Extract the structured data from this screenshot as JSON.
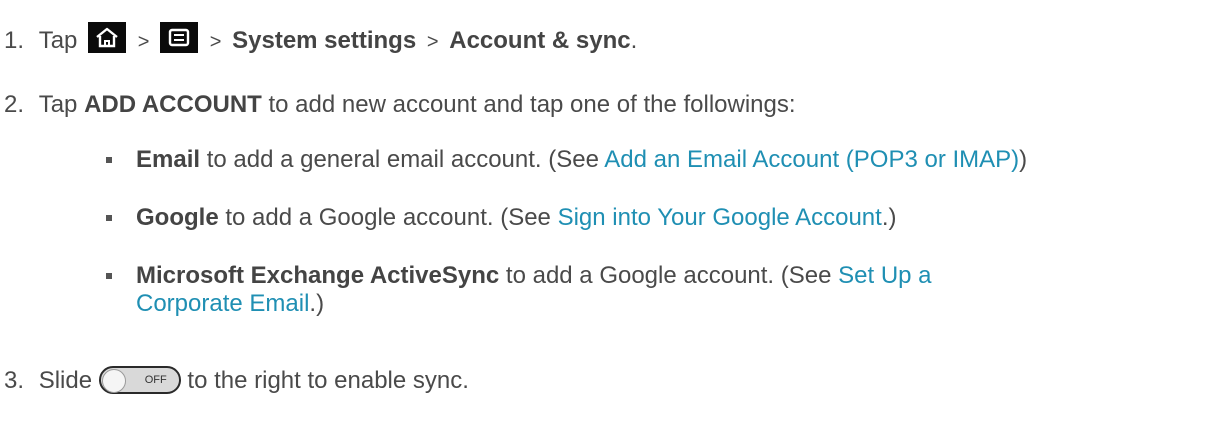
{
  "steps": [
    {
      "number": "1.",
      "tap": "Tap",
      "sep1": ">",
      "sep2": ">",
      "system_settings": "System settings",
      "sep3": ">",
      "account_sync": "Account & sync",
      "end": ".",
      "icons": [
        "home-icon",
        "menu-icon"
      ]
    },
    {
      "number": "2.",
      "tap": "Tap",
      "add_account": "ADD ACCOUNT",
      "rest": "to add new account and tap one of the followings:"
    },
    {
      "number": "3.",
      "slide": "Slide",
      "toggle_label": "OFF",
      "rest": "to the right to enable sync."
    }
  ],
  "options": [
    {
      "bold": "Email",
      "text": "to add a general email account. (See",
      "link": "Add an Email Account (POP3 or IMAP)",
      "after": ")"
    },
    {
      "bold": "Google",
      "text": "to add a Google account. (See",
      "link": "Sign into Your Google Account",
      "after": ".)"
    },
    {
      "bold": "Microsoft Exchange ActiveSync",
      "text": "to add a Google account. (See",
      "link_line1": "Set Up a",
      "link_line2": "Corporate Email",
      "after": ".)"
    }
  ],
  "colors": {
    "text": "#4a4a4a",
    "link": "#1f8fb3",
    "icon_bg": "#0a0a0a"
  }
}
